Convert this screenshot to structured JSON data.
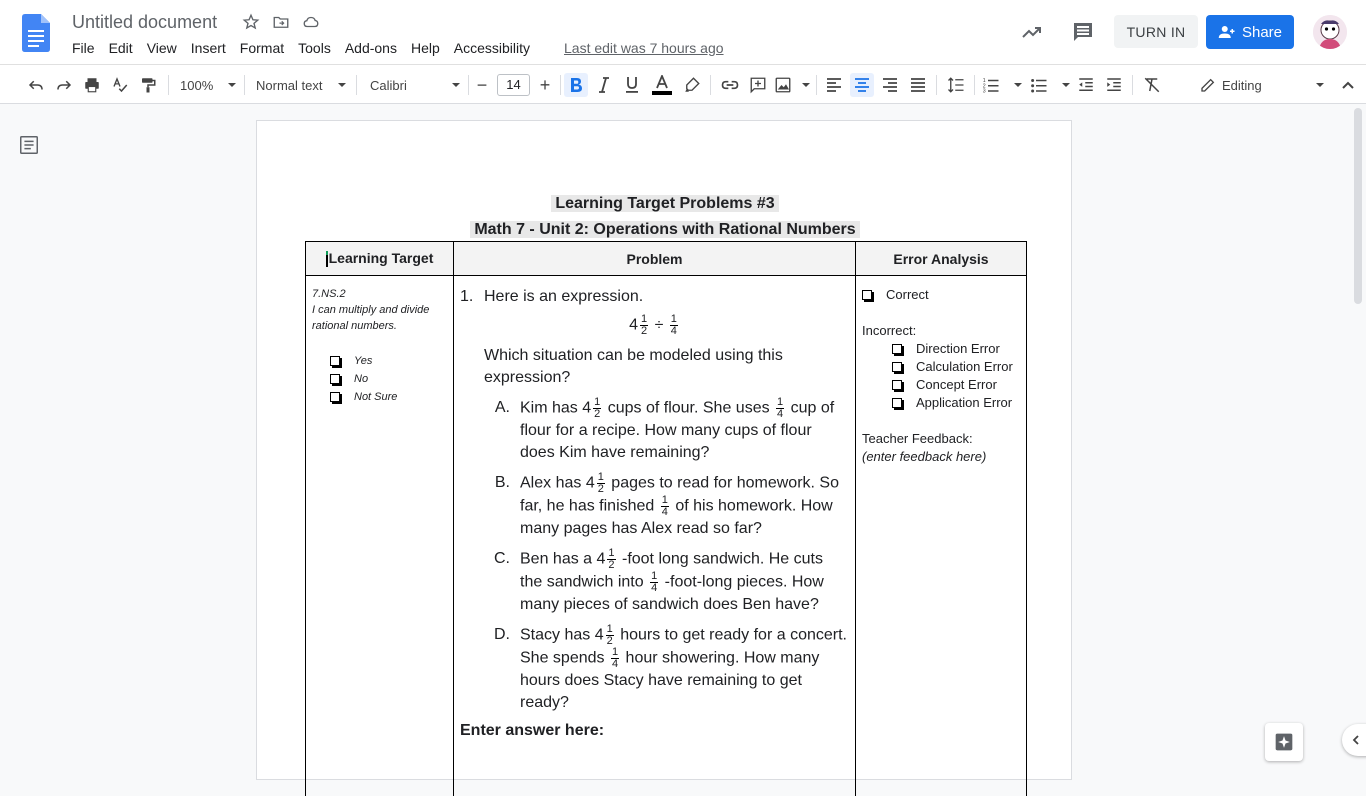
{
  "header": {
    "title": "Untitled document",
    "menus": [
      "File",
      "Edit",
      "View",
      "Insert",
      "Format",
      "Tools",
      "Add-ons",
      "Help",
      "Accessibility"
    ],
    "last_edit": "Last edit was 7 hours ago",
    "turn_in": "TURN IN",
    "share": "Share"
  },
  "toolbar": {
    "zoom": "100%",
    "style": "Normal text",
    "font": "Calibri",
    "font_size": "14",
    "mode": "Editing",
    "text_color": "#000000"
  },
  "document": {
    "heading_line1": "Learning Target Problems #3",
    "heading_line2": "Math 7 - Unit 2: Operations with Rational Numbers",
    "table": {
      "headers": [
        "Learning Target",
        "Problem",
        "Error Analysis"
      ],
      "learning_target": {
        "code": "7.NS.2",
        "description": "I can multiply and divide rational numbers.",
        "options": [
          "Yes",
          "No",
          "Not Sure"
        ]
      },
      "problem": {
        "number": "1.",
        "prompt": "Here is an expression.",
        "expression_whole": "4",
        "expression_op": "÷",
        "question": "Which situation can be modeled using this expression?",
        "options": [
          {
            "letter": "A.",
            "p1": "Kim has",
            "p2": "cups of flour.  She uses",
            "p3": "cup of flour for a recipe. How many cups of flour does Kim have remaining?"
          },
          {
            "letter": "B.",
            "p1": "Alex has",
            "p2": "pages to read for homework. So far, he has finished",
            "p3": "of his homework. How many pages has Alex read so far?"
          },
          {
            "letter": "C.",
            "p1": "Ben has a",
            "p2": "-foot long sandwich. He cuts the sandwich into",
            "p3": "-foot-long pieces. How many pieces of sandwich does Ben have?"
          },
          {
            "letter": "D.",
            "p1": "Stacy has",
            "p2": " hours to get ready for a concert. She spends",
            "p3": "hour showering. How many hours does Stacy have remaining to get ready?"
          }
        ],
        "answer_label": "Enter answer here:"
      },
      "error_analysis": {
        "correct": "Correct",
        "incorrect_label": "Incorrect:",
        "errors": [
          "Direction Error",
          "Calculation Error",
          "Concept Error",
          "Application Error"
        ],
        "feedback_label": "Teacher Feedback:",
        "feedback_placeholder": "(enter feedback here)"
      }
    }
  },
  "icons": [
    "docs-logo-icon",
    "star-icon",
    "move-to-folder-icon",
    "cloud-status-icon",
    "trending-icon",
    "comment-icon",
    "share-person-icon",
    "undo-icon",
    "redo-icon",
    "print-icon",
    "spellcheck-icon",
    "paint-format-icon",
    "bold-icon",
    "italic-icon",
    "underline-icon",
    "text-color-icon",
    "highlight-icon",
    "link-icon",
    "add-comment-icon",
    "image-icon",
    "align-left-icon",
    "align-center-icon",
    "align-right-icon",
    "justify-icon",
    "line-spacing-icon",
    "numbered-list-icon",
    "bulleted-list-icon",
    "decrease-indent-icon",
    "increase-indent-icon",
    "clear-formatting-icon",
    "pencil-icon",
    "collapse-icon",
    "outline-icon",
    "explore-icon",
    "chevron-left-icon"
  ]
}
